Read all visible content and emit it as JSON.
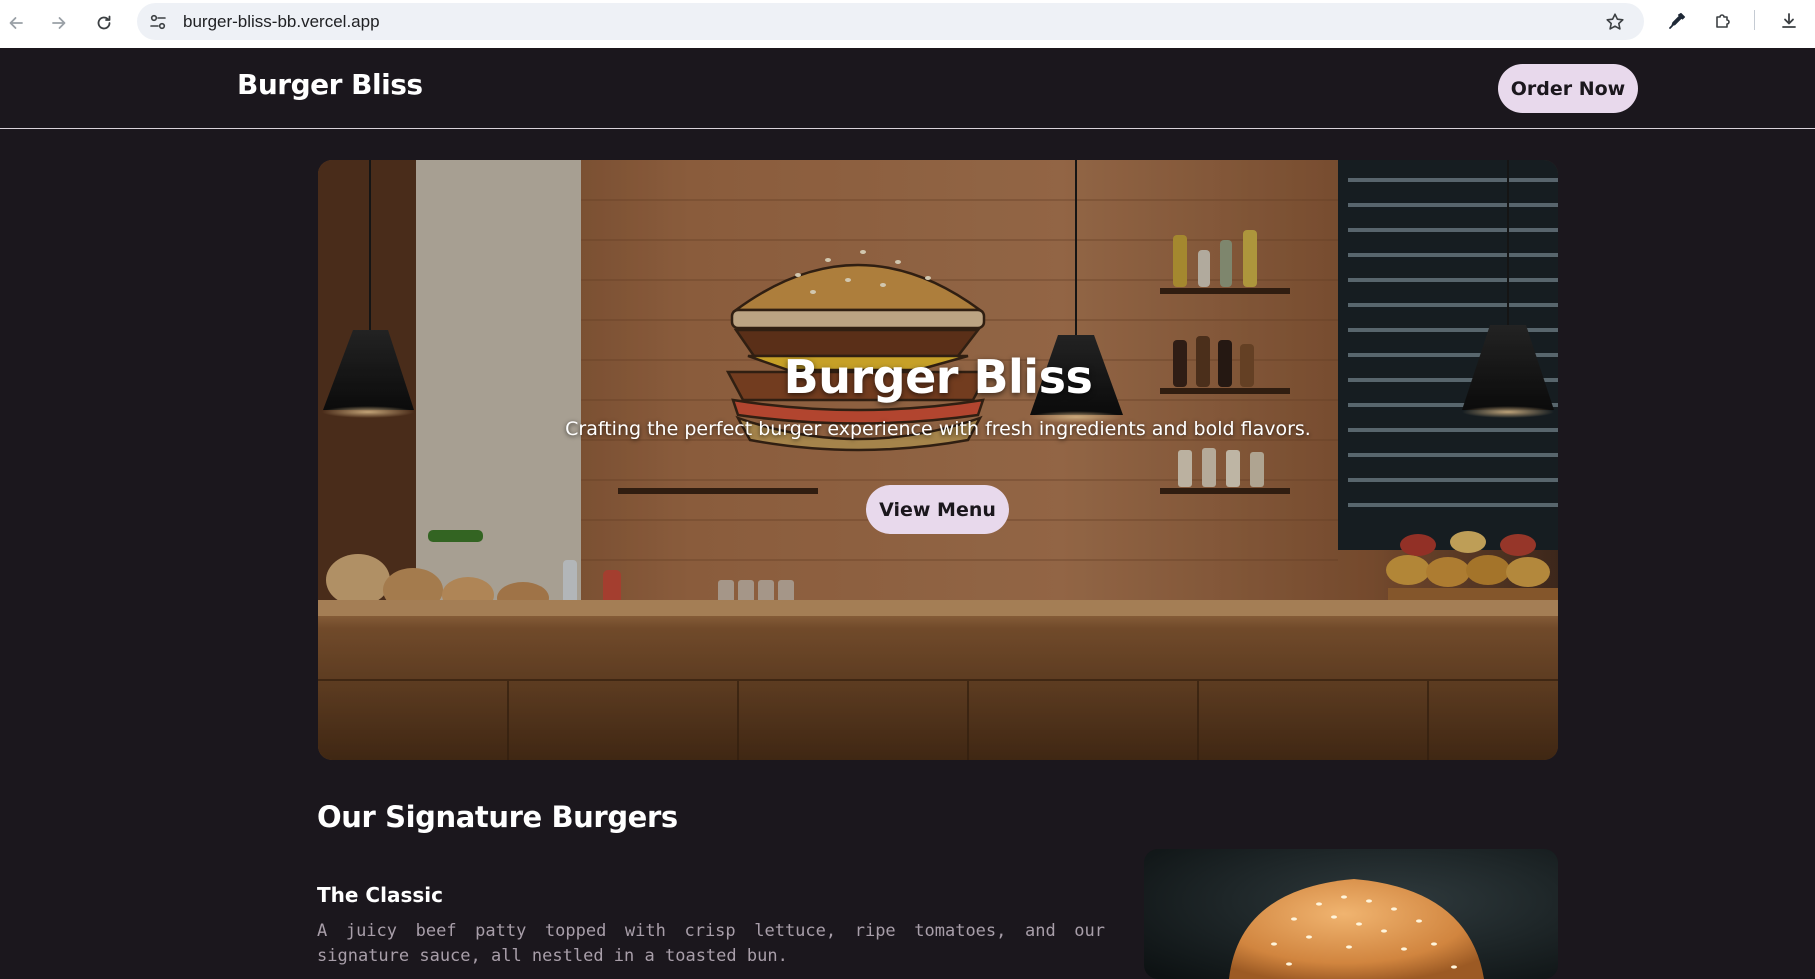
{
  "browser": {
    "url": "burger-bliss-bb.vercel.app"
  },
  "header": {
    "brand": "Burger Bliss",
    "order_button": "Order Now"
  },
  "hero": {
    "title": "Burger Bliss",
    "subtitle": "Crafting the perfect burger experience with fresh ingredients and bold flavors.",
    "cta": "View Menu"
  },
  "signature": {
    "title": "Our Signature Burgers",
    "items": [
      {
        "name": "The Classic",
        "description": "A juicy beef patty topped with crisp lettuce, ripe tomatoes, and our signature sauce, all nestled in a toasted bun."
      }
    ]
  },
  "colors": {
    "background": "#1b171d",
    "accent_button": "#e8d9ec",
    "muted_text": "#a89ea9"
  }
}
